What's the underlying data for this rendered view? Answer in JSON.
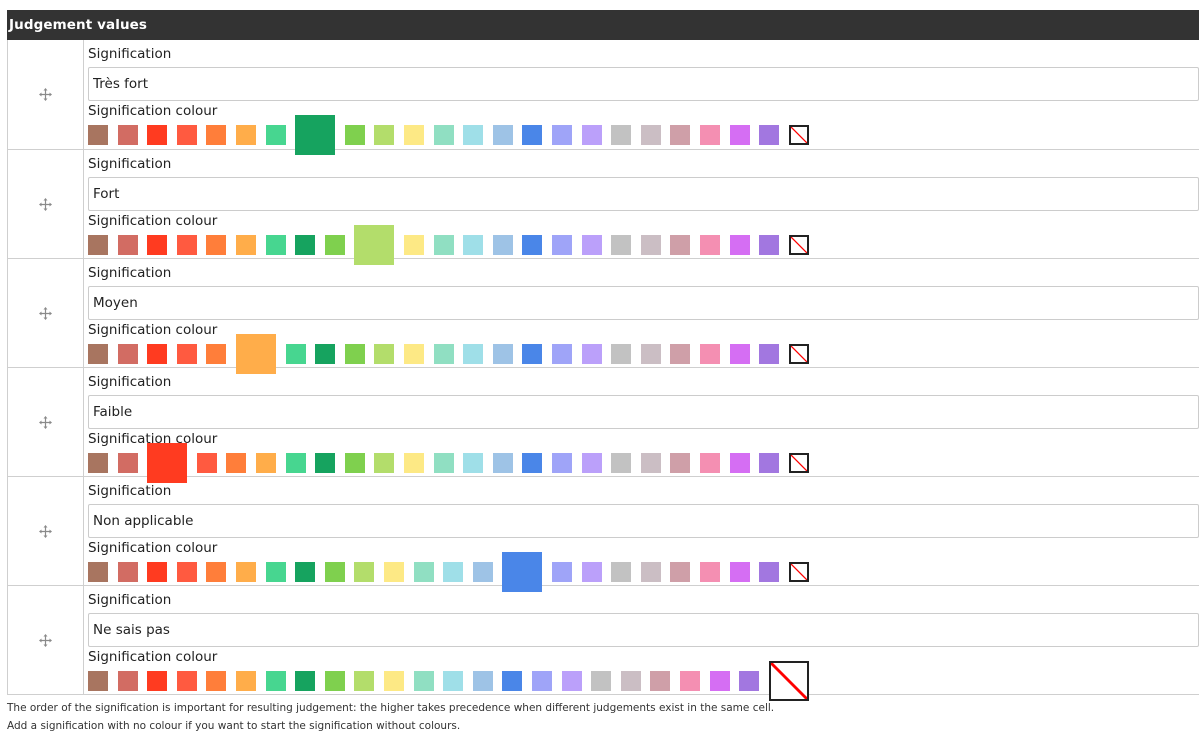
{
  "header": {
    "title": "Judgement values"
  },
  "labels": {
    "signification": "Signification",
    "colour": "Signification colour"
  },
  "palette": [
    "#a87560",
    "#d26c63",
    "#ff3b20",
    "#ff5a40",
    "#ff7e3a",
    "#ffad4a",
    "#47d690",
    "#16a35f",
    "#7fd04e",
    "#b3dd6b",
    "#fde985",
    "#90dfc2",
    "#9fdfe8",
    "#9ec3e6",
    "#4a86e8",
    "#9fa4f8",
    "#bba0fa",
    "#c2c2c2",
    "#cbbec4",
    "#cf9fa8",
    "#f48fb2",
    "#d56ef3",
    "#a277e0"
  ],
  "no_colour_icon": "no-colour-icon",
  "rows": [
    {
      "value": "Très fort",
      "selected": 7
    },
    {
      "value": "Fort",
      "selected": 9
    },
    {
      "value": "Moyen",
      "selected": 5
    },
    {
      "value": "Faible",
      "selected": 2
    },
    {
      "value": "Non applicable",
      "selected": 14
    },
    {
      "value": "Ne sais pas",
      "selected": "none"
    }
  ],
  "footer": {
    "line1": "The order of the signification is important for resulting judgement: the higher takes precedence when different judgements exist in the same cell.",
    "line2": "Add a signification with no colour if you want to start the signification without colours."
  }
}
